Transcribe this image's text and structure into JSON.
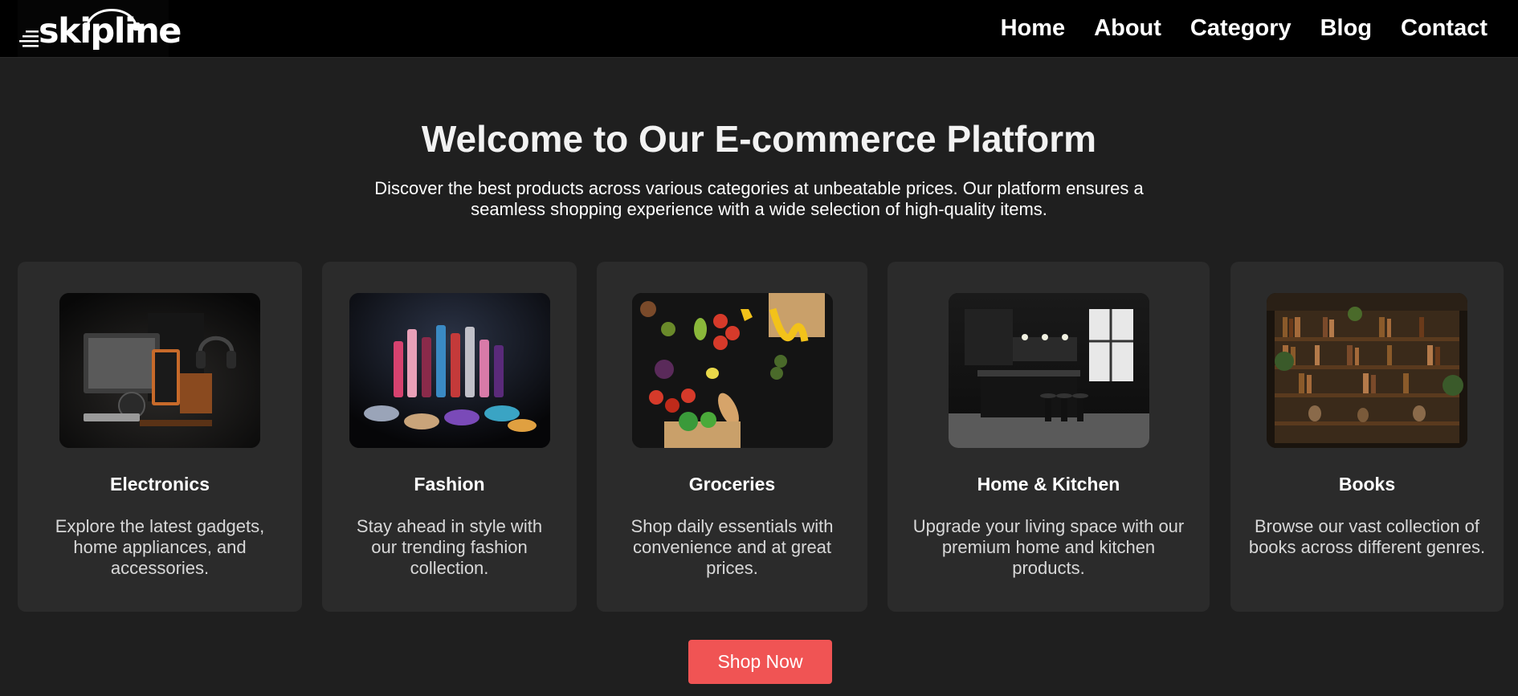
{
  "brand": {
    "logo_text": "skipline"
  },
  "nav": {
    "home": "Home",
    "about": "About",
    "category": "Category",
    "blog": "Blog",
    "contact": "Contact"
  },
  "hero": {
    "title": "Welcome to Our E-commerce Platform",
    "description": "Discover the best products across various categories at unbeatable prices. Our platform ensures a seamless shopping experience with a wide selection of high-quality items."
  },
  "categories": [
    {
      "title": "Electronics",
      "description": "Explore the latest gadgets, home appliances, and accessories.",
      "image": "electronics-photo"
    },
    {
      "title": "Fashion",
      "description": "Stay ahead in style with our trending fashion collection.",
      "image": "cosmetics-photo"
    },
    {
      "title": "Groceries",
      "description": "Shop daily essentials with convenience and at great prices.",
      "image": "groceries-photo"
    },
    {
      "title": "Home & Kitchen",
      "description": "Upgrade your living space with our premium home and kitchen products.",
      "image": "kitchen-photo"
    },
    {
      "title": "Books",
      "description": "Browse our vast collection of books across different genres.",
      "image": "bookshelf-photo"
    }
  ],
  "cta": {
    "label": "Shop Now"
  },
  "colors": {
    "page_bg": "#1f1f1f",
    "card_bg": "#2b2b2b",
    "header_bg": "#000000",
    "accent": "#f05454"
  }
}
